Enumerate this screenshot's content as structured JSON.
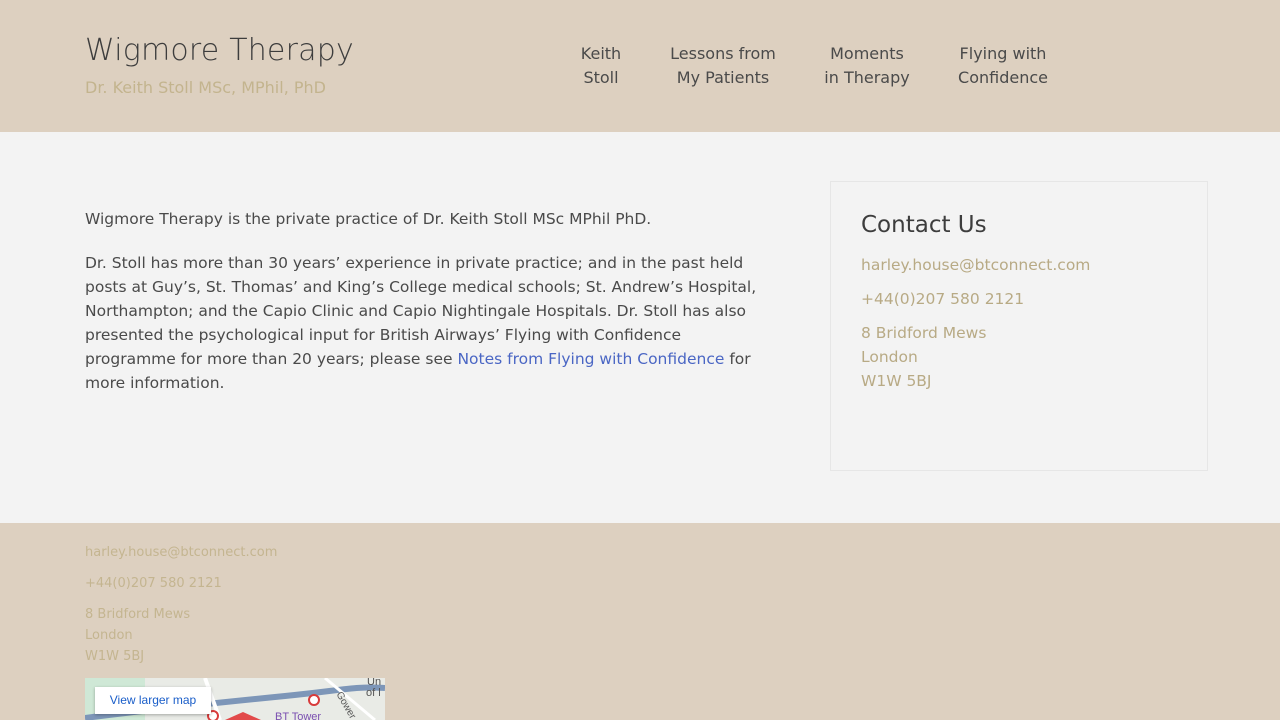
{
  "header": {
    "title": "Wigmore Therapy",
    "tagline": "Dr. Keith Stoll MSc, MPhil, PhD",
    "nav": [
      {
        "line1": "Keith",
        "line2": "Stoll"
      },
      {
        "line1": "Lessons from",
        "line2": "My Patients"
      },
      {
        "line1": "Moments",
        "line2": "in Therapy"
      },
      {
        "line1": "Flying with",
        "line2": "Confidence"
      }
    ]
  },
  "main": {
    "intro": "Wigmore Therapy is the private practice of Dr. Keith Stoll MSc MPhil PhD.",
    "body_before_link": "Dr. Stoll has more than 30 years’ experience in private practice; and in the past held posts at Guy’s, St. Thomas’ and King’s College medical schools; St. Andrew’s Hospital, Northampton; and the Capio Clinic and Capio Nightingale Hospitals. Dr. Stoll has also presented the psychological input for British Airways’ Flying with Confidence programme for more than 20 years; please see ",
    "link_text": "Notes from Flying with Confidence",
    "body_after_link": " for more information."
  },
  "contact": {
    "heading": "Contact Us",
    "email": "harley.house@btconnect.com",
    "phone": "+44(0)207 580 2121",
    "address": [
      "8 Bridford Mews",
      "London",
      "W1W 5BJ"
    ]
  },
  "footer": {
    "email": "harley.house@btconnect.com",
    "phone": "+44(0)207 580 2121",
    "address": [
      "8 Bridford Mews",
      "London",
      "W1W 5BJ"
    ],
    "map": {
      "button_label": "View larger map",
      "labels": [
        "Un",
        "of l",
        "Gower",
        "BT Tower"
      ]
    }
  },
  "colors": {
    "header_bg": "#ddd0c0",
    "accent": "#c3b48e",
    "link": "#4a66c4"
  }
}
